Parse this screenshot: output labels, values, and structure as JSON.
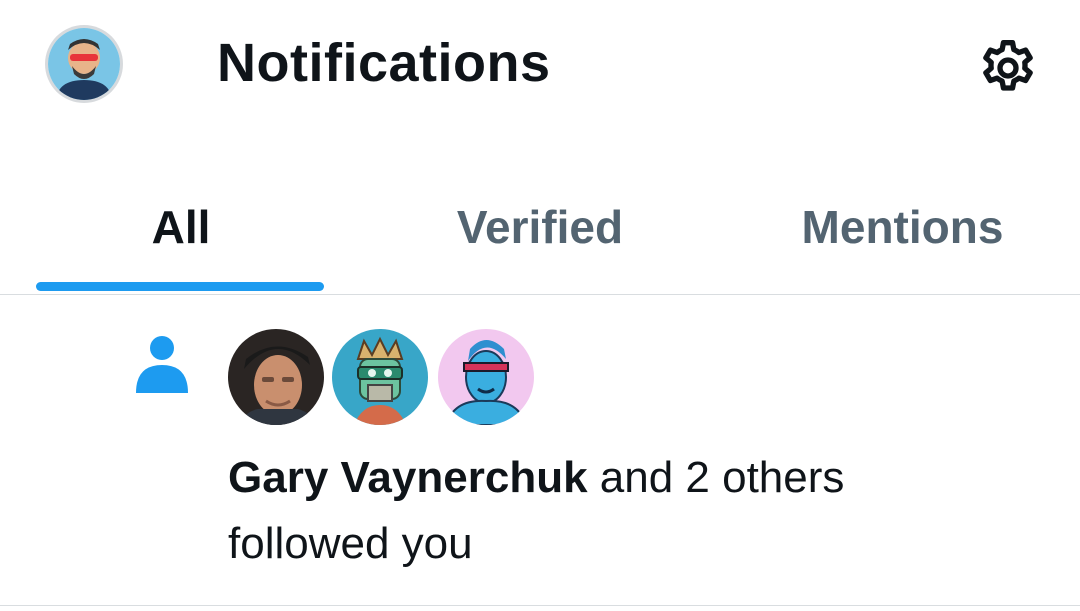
{
  "header": {
    "title": "Notifications",
    "profile_avatar_icon": "user-avatar-icon",
    "settings_icon": "gear-icon"
  },
  "tabs": [
    {
      "label": "All",
      "active": true
    },
    {
      "label": "Verified",
      "active": false
    },
    {
      "label": "Mentions",
      "active": false
    }
  ],
  "notifications": [
    {
      "type_icon": "person-icon",
      "avatars": [
        "avatar-photo",
        "avatar-nft-ape",
        "avatar-nft-blue"
      ],
      "name": "Gary Vaynerchuk",
      "text_inline": " and 2 others",
      "text_wrap": "followed you"
    }
  ],
  "colors": {
    "accent": "#1d9bf0",
    "text_primary": "#0f1419",
    "text_secondary": "#536471",
    "divider": "#d9dde0"
  }
}
